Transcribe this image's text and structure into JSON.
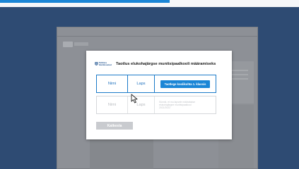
{
  "modal": {
    "logo_lines": [
      "Tallinna",
      "Haridusamet"
    ],
    "title": "Taotlus elukohajärgse munitsipaalkooli määramiseks",
    "rows": [
      {
        "name": "Nimi",
        "child": "Laps",
        "action_label": "Taotlege koolikohta 1. klassis",
        "state": "active"
      },
      {
        "name": "Nimi",
        "child": "Laps",
        "info_lines": [
          "Sünnik, et mu lapsele määratakse",
          "elukohajärgne munitsipaalkool",
          "2021/2022"
        ],
        "state": "disabled"
      }
    ],
    "cancel_label": "Katkesta"
  },
  "colors": {
    "background": "#2e4b73",
    "accent": "#1b86d6",
    "active_border": "#1b7ac8",
    "disabled_text": "#b8bbbf"
  },
  "icons": {
    "logo": "tallinn-crest-icon",
    "cursor": "mouse-pointer-icon"
  }
}
